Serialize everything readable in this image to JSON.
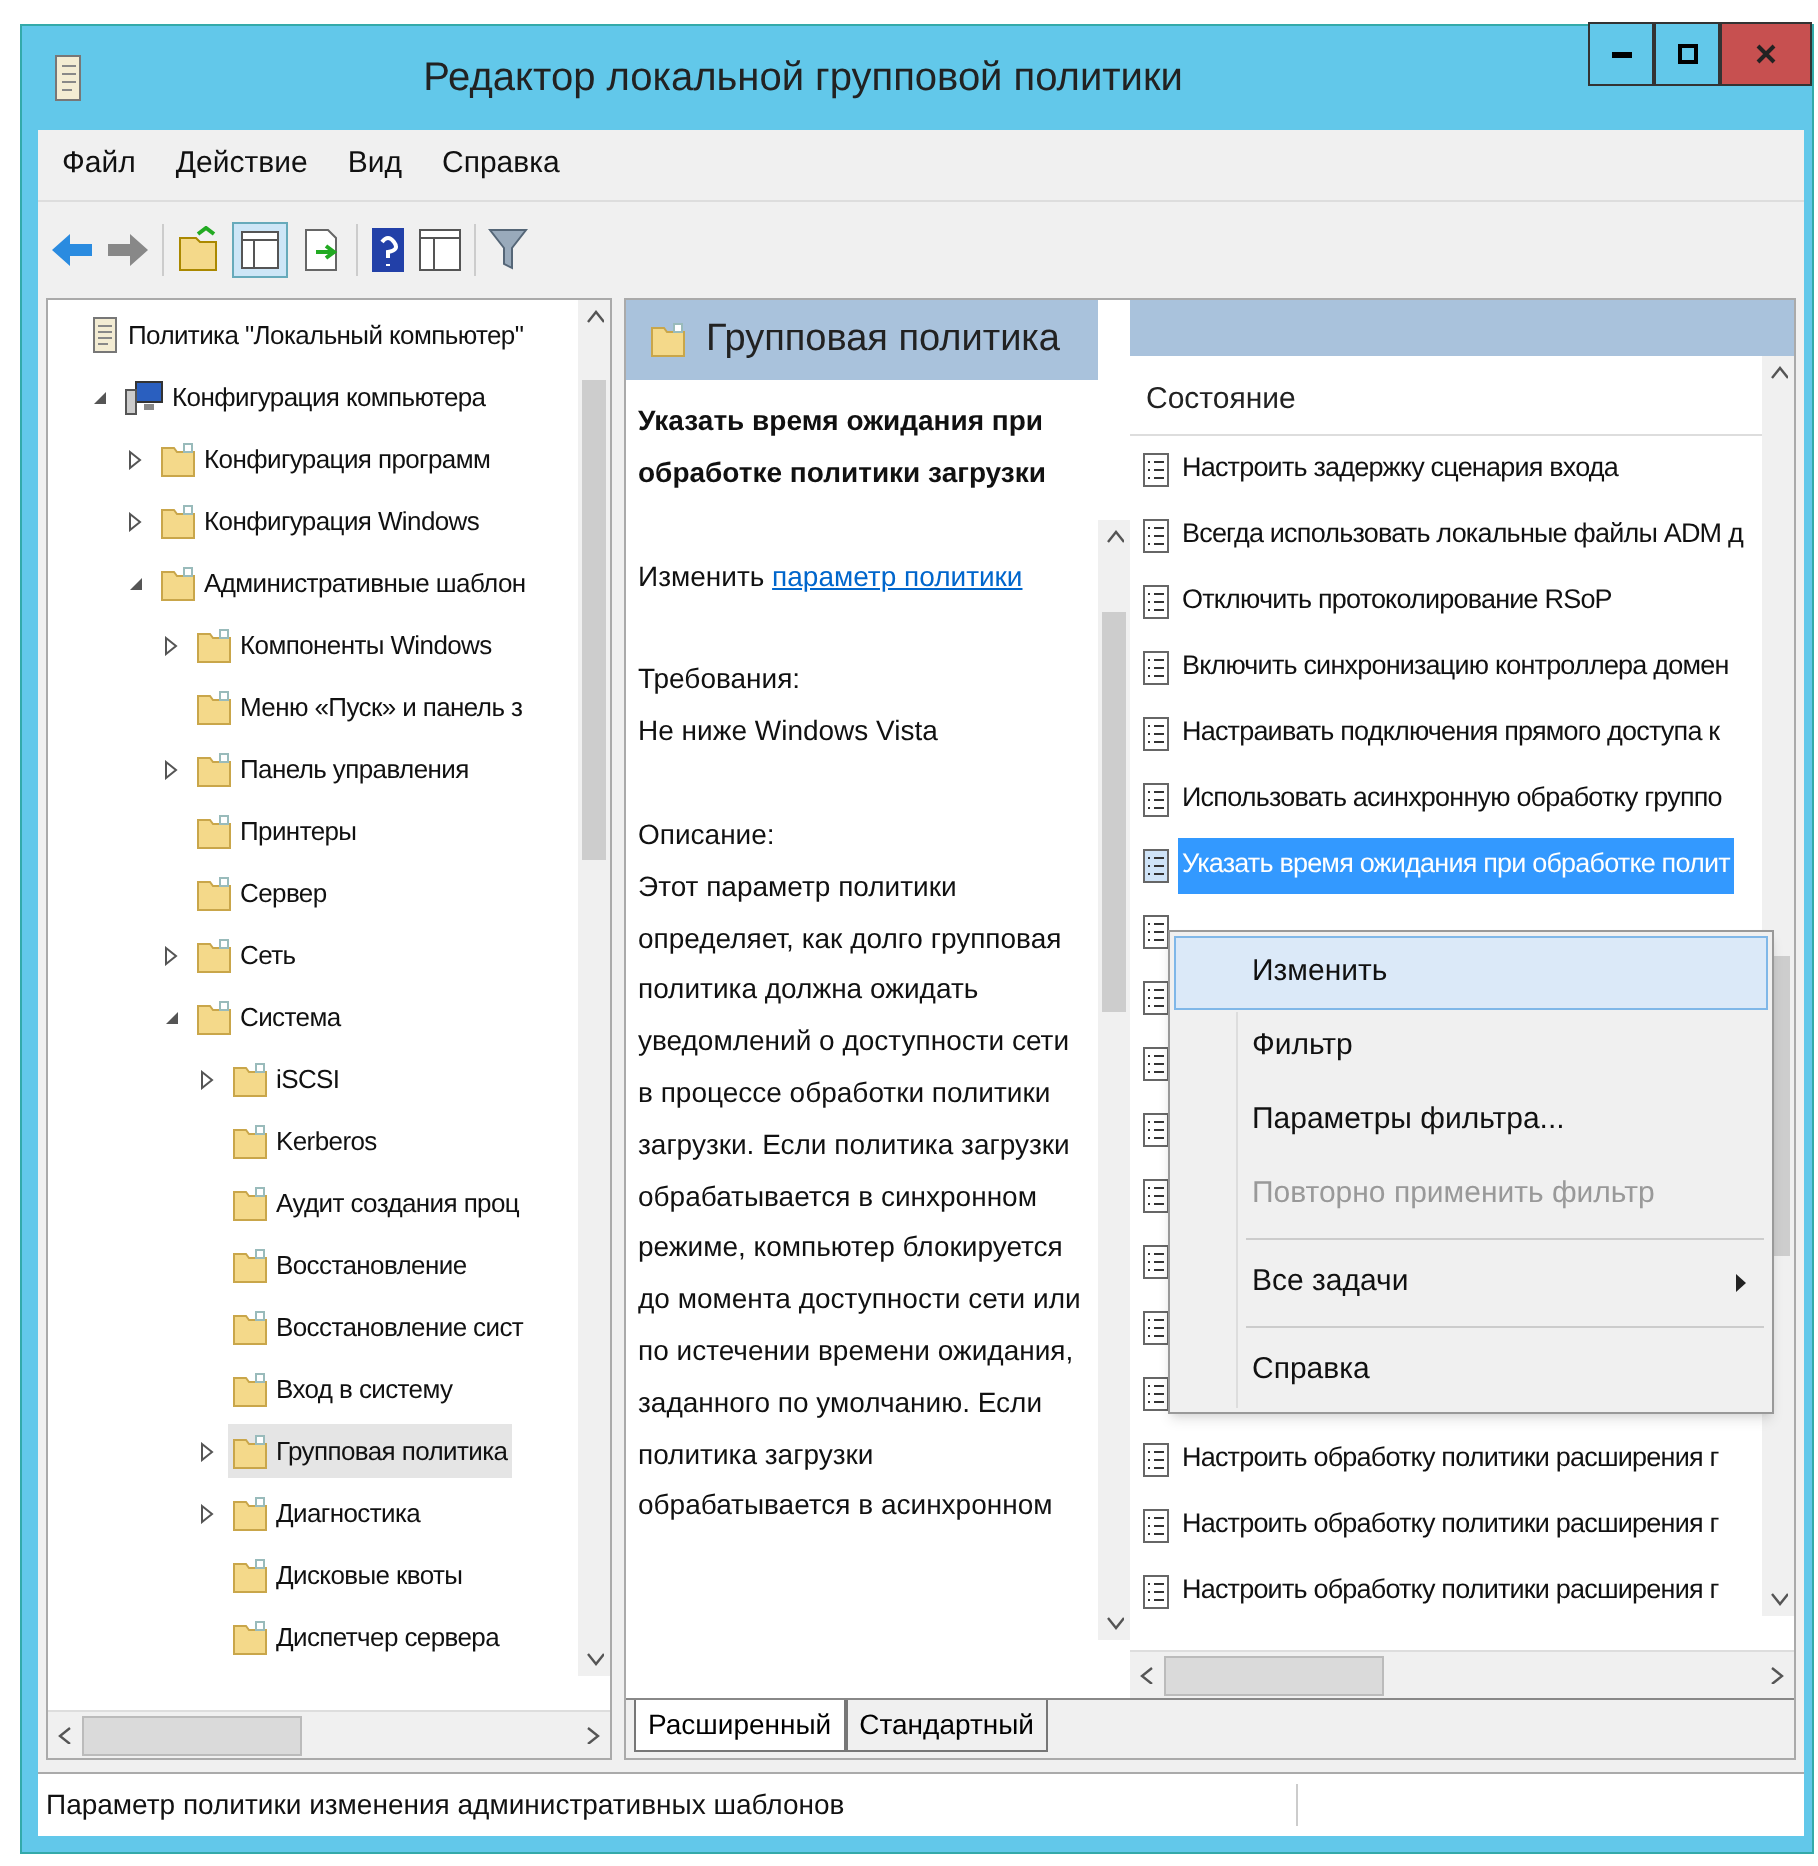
{
  "window": {
    "title": "Редактор локальной групповой политики"
  },
  "menu": [
    "Файл",
    "Действие",
    "Вид",
    "Справка"
  ],
  "tree": {
    "items": [
      {
        "label": "Политика \"Локальный компьютер\"",
        "kind": "root",
        "selected": false,
        "children": [
          {
            "label": "Конфигурация компьютера",
            "kind": "computer",
            "expanded": true,
            "selected": false,
            "children": [
              {
                "label": "Конфигурация программ",
                "kind": "folder",
                "expanded": false,
                "selected": false
              },
              {
                "label": "Конфигурация Windows",
                "kind": "folder",
                "expanded": false,
                "selected": false
              },
              {
                "label": "Административные шаблон",
                "kind": "folder",
                "expanded": true,
                "selected": false,
                "children": [
                  {
                    "label": "Компоненты Windows",
                    "kind": "folder",
                    "expanded": false,
                    "selected": false
                  },
                  {
                    "label": "Меню «Пуск» и панель з",
                    "kind": "folder",
                    "selected": false
                  },
                  {
                    "label": "Панель управления",
                    "kind": "folder",
                    "expanded": false,
                    "selected": false
                  },
                  {
                    "label": "Принтеры",
                    "kind": "folder",
                    "selected": false
                  },
                  {
                    "label": "Сервер",
                    "kind": "folder",
                    "selected": false
                  },
                  {
                    "label": "Сеть",
                    "kind": "folder",
                    "expanded": false,
                    "selected": false
                  },
                  {
                    "label": "Система",
                    "kind": "folder",
                    "expanded": true,
                    "selected": false,
                    "children": [
                      {
                        "label": "iSCSI",
                        "kind": "folder",
                        "expanded": false,
                        "selected": false
                      },
                      {
                        "label": "Kerberos",
                        "kind": "folder",
                        "selected": false
                      },
                      {
                        "label": "Аудит создания проц",
                        "kind": "folder",
                        "selected": false
                      },
                      {
                        "label": "Восстановление",
                        "kind": "folder",
                        "selected": false
                      },
                      {
                        "label": "Восстановление сист",
                        "kind": "folder",
                        "selected": false
                      },
                      {
                        "label": "Вход в систему",
                        "kind": "folder",
                        "selected": false
                      },
                      {
                        "label": "Групповая политика",
                        "kind": "folder",
                        "expanded": false,
                        "selected": true
                      },
                      {
                        "label": "Диагностика",
                        "kind": "folder",
                        "expanded": false,
                        "selected": false
                      },
                      {
                        "label": "Дисковые квоты",
                        "kind": "folder",
                        "selected": false
                      },
                      {
                        "label": "Диспетчер сервера",
                        "kind": "folder",
                        "selected": false
                      }
                    ]
                  }
                ]
              }
            ]
          }
        ]
      }
    ]
  },
  "details": {
    "header": "Групповая политика",
    "policy_title": "Указать время ожидания при обработке политики загрузки",
    "edit_prefix": "Изменить",
    "edit_link": "параметр политики",
    "requirements_label": "Требования:",
    "requirements": "Не ниже Windows Vista",
    "description_label": "Описание:",
    "description": "Этот параметр политики определяет, как долго групповая политика должна ожидать уведомлений о доступности сети в процессе обработки политики загрузки. Если политика загрузки обрабатывается в синхронном режиме, компьютер блокируется до момента доступности сети или по истечении времени ожидания, заданного по умолчанию. Если политика загрузки обрабатывается в асинхронном"
  },
  "list": {
    "column": "Состояние",
    "rows": [
      {
        "text": "Настроить задержку сценария входа",
        "selected": false,
        "covered": false
      },
      {
        "text": "Всегда использовать локальные файлы ADM д",
        "selected": false,
        "covered": false
      },
      {
        "text": "Отключить протоколирование RSoP",
        "selected": false,
        "covered": false
      },
      {
        "text": "Включить синхронизацию контроллера домен",
        "selected": false,
        "covered": false
      },
      {
        "text": "Настраивать подключения прямого доступа к",
        "selected": false,
        "covered": false
      },
      {
        "text": "Использовать асинхронную обработку группо",
        "selected": false,
        "covered": false
      },
      {
        "text": "Указать время ожидания при обработке полит",
        "selected": true,
        "covered": false
      },
      {
        "selected": false,
        "covered": true
      },
      {
        "selected": false,
        "covered": true
      },
      {
        "selected": false,
        "covered": true
      },
      {
        "selected": false,
        "covered": true
      },
      {
        "selected": false,
        "covered": true
      },
      {
        "selected": false,
        "covered": true
      },
      {
        "selected": false,
        "covered": true
      },
      {
        "selected": false,
        "covered": true
      },
      {
        "text": "Настроить обработку политики расширения г",
        "selected": false,
        "covered": false
      },
      {
        "text": "Настроить обработку политики расширения г",
        "selected": false,
        "covered": false
      },
      {
        "text": "Настроить обработку политики расширения г",
        "selected": false,
        "covered": false
      }
    ]
  },
  "context_menu": [
    {
      "kind": "item",
      "label": "Изменить",
      "selected": true,
      "disabled": false,
      "submenu": false
    },
    {
      "kind": "item",
      "label": "Фильтр",
      "selected": false,
      "disabled": false,
      "submenu": false
    },
    {
      "kind": "item",
      "label": "Параметры фильтра...",
      "selected": false,
      "disabled": false,
      "submenu": false
    },
    {
      "kind": "item",
      "label": "Повторно применить фильтр",
      "selected": false,
      "disabled": true,
      "submenu": false
    },
    {
      "kind": "separator"
    },
    {
      "kind": "item",
      "label": "Все задачи",
      "selected": false,
      "disabled": false,
      "submenu": true
    },
    {
      "kind": "separator"
    },
    {
      "kind": "item",
      "label": "Справка",
      "selected": false,
      "disabled": false,
      "submenu": false
    }
  ],
  "tabs": [
    {
      "label": "Расширенный",
      "selected": true
    },
    {
      "label": "Стандартный",
      "selected": false
    }
  ],
  "status_bar": "Параметр политики изменения административных шаблонов"
}
